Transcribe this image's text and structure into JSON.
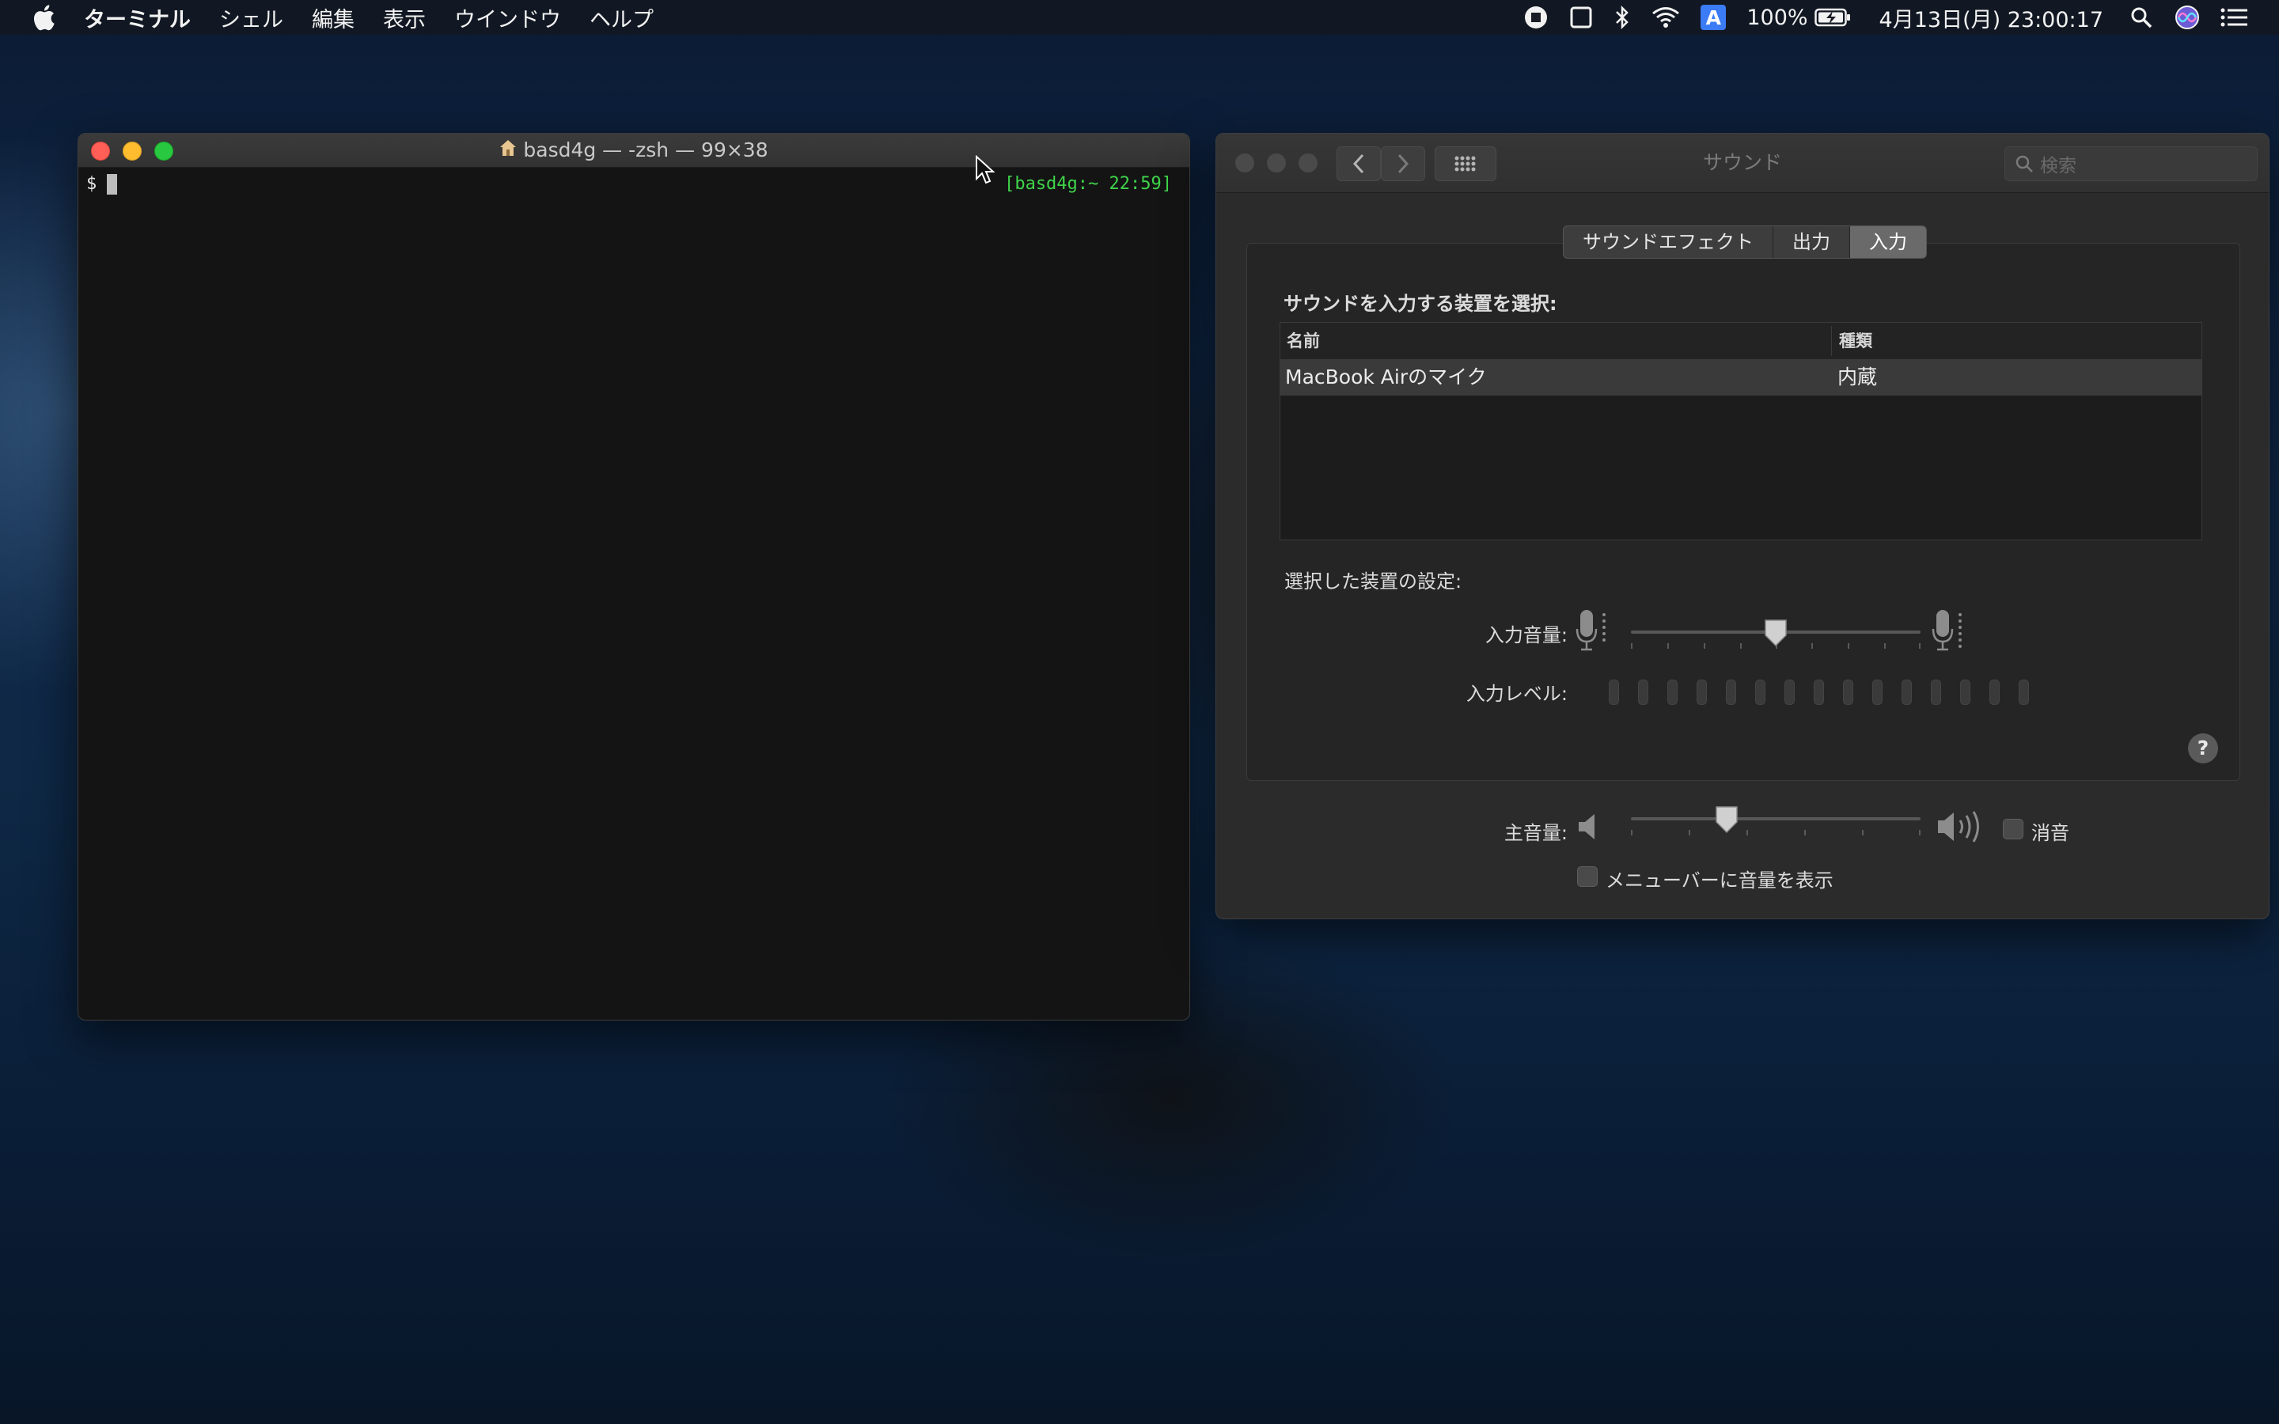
{
  "menubar": {
    "app_name": "ターミナル",
    "items": [
      "シェル",
      "編集",
      "表示",
      "ウインドウ",
      "ヘルプ"
    ],
    "battery": "100%",
    "input_source": "A",
    "datetime": "4月13日(月) 23:00:17",
    "icons": [
      "apple-icon",
      "record-icon",
      "window-icon",
      "bluetooth-icon",
      "wifi-icon",
      "input-source-icon",
      "battery-icon",
      "spotlight-icon",
      "siri-icon",
      "notification-center-icon"
    ]
  },
  "terminal": {
    "title": "basd4g — -zsh — 99×38",
    "prompt": "$",
    "right_prompt": "[basd4g:~ 22:59]",
    "prompt_color": "#3fd44a"
  },
  "sound": {
    "title": "サウンド",
    "search_placeholder": "検索",
    "tabs": [
      "サウンドエフェクト",
      "出力",
      "入力"
    ],
    "selected_tab": "入力",
    "select_device_label": "サウンドを入力する装置を選択:",
    "table": {
      "columns": [
        "名前",
        "種類"
      ],
      "rows": [
        {
          "name": "MacBook Airのマイク",
          "type": "内蔵"
        }
      ]
    },
    "selected_device_label": "選択した装置の設定:",
    "input_volume_label": "入力音量:",
    "input_volume_fraction": 0.5,
    "input_level_label": "入力レベル:",
    "input_level_fraction": 0,
    "help_label": "?",
    "output_volume_label": "主音量:",
    "output_volume_fraction": 0.33,
    "mute_label": "消音",
    "mute_checked": false,
    "show_in_menubar_label": "メニューバーに音量を表示",
    "show_in_menubar_checked": false
  }
}
